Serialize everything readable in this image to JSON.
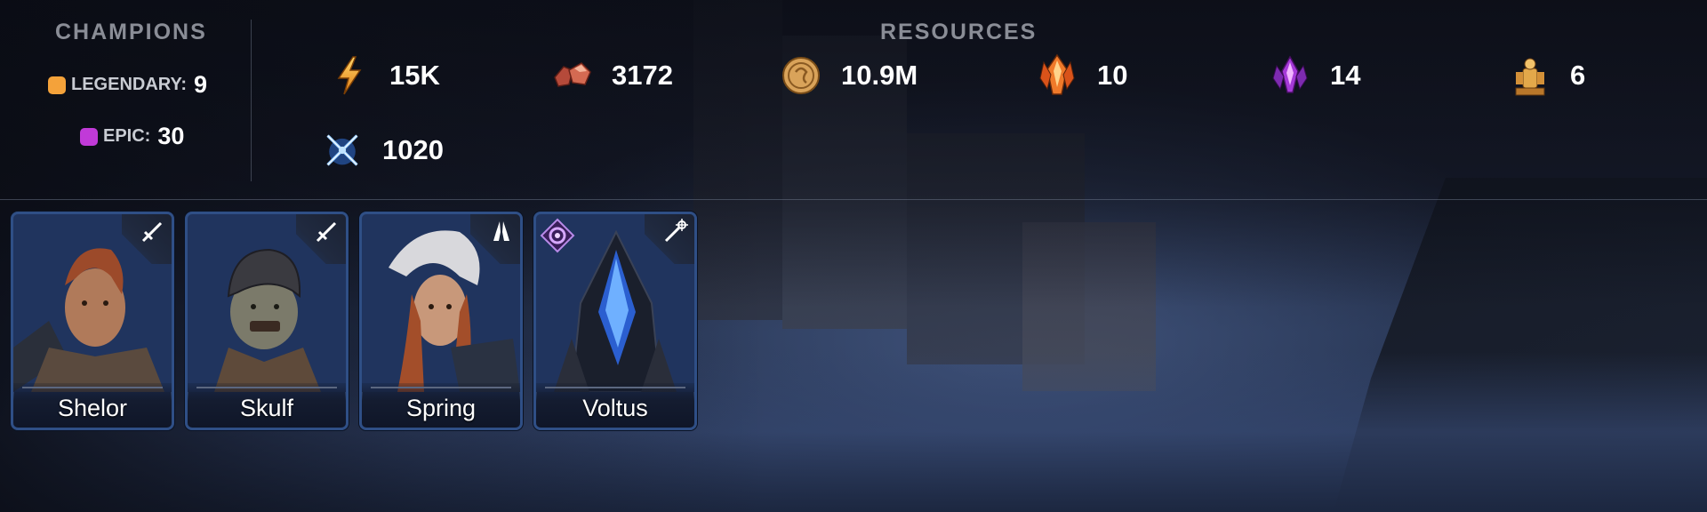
{
  "champions": {
    "title": "CHAMPIONS",
    "rarities": [
      {
        "label": "LEGENDARY:",
        "value": "9",
        "color": "#f4a23a"
      },
      {
        "label": "EPIC:",
        "value": "30",
        "color": "#c13ad8"
      }
    ]
  },
  "resources": {
    "title": "RESOURCES",
    "items": [
      {
        "icon": "energy-bolt-icon",
        "value": "15K"
      },
      {
        "icon": "rubies-icon",
        "value": "3172"
      },
      {
        "icon": "silver-coin-icon",
        "value": "10.9M"
      },
      {
        "icon": "fire-shard-icon",
        "value": "10"
      },
      {
        "icon": "void-shard-icon",
        "value": "14"
      },
      {
        "icon": "golden-statue-icon",
        "value": "6"
      },
      {
        "icon": "arena-swords-icon",
        "value": "1020"
      }
    ]
  },
  "cards": [
    {
      "name": "Shelor",
      "class_icon": "sword-class-icon",
      "affinity_icon": "",
      "skin": "#b07a5a",
      "hair": "#9c4a2a"
    },
    {
      "name": "Skulf",
      "class_icon": "sword-class-icon",
      "affinity_icon": "",
      "skin": "#7b7a6a",
      "hair": "#3a3a40"
    },
    {
      "name": "Spring",
      "class_icon": "praying-hands-class-icon",
      "affinity_icon": "",
      "skin": "#c8987a",
      "hair": "#a34e2a"
    },
    {
      "name": "Voltus",
      "class_icon": "staff-class-icon",
      "affinity_icon": "void-affinity-icon",
      "skin": "#2b5fd0",
      "hair": "#1a1f2c"
    }
  ]
}
